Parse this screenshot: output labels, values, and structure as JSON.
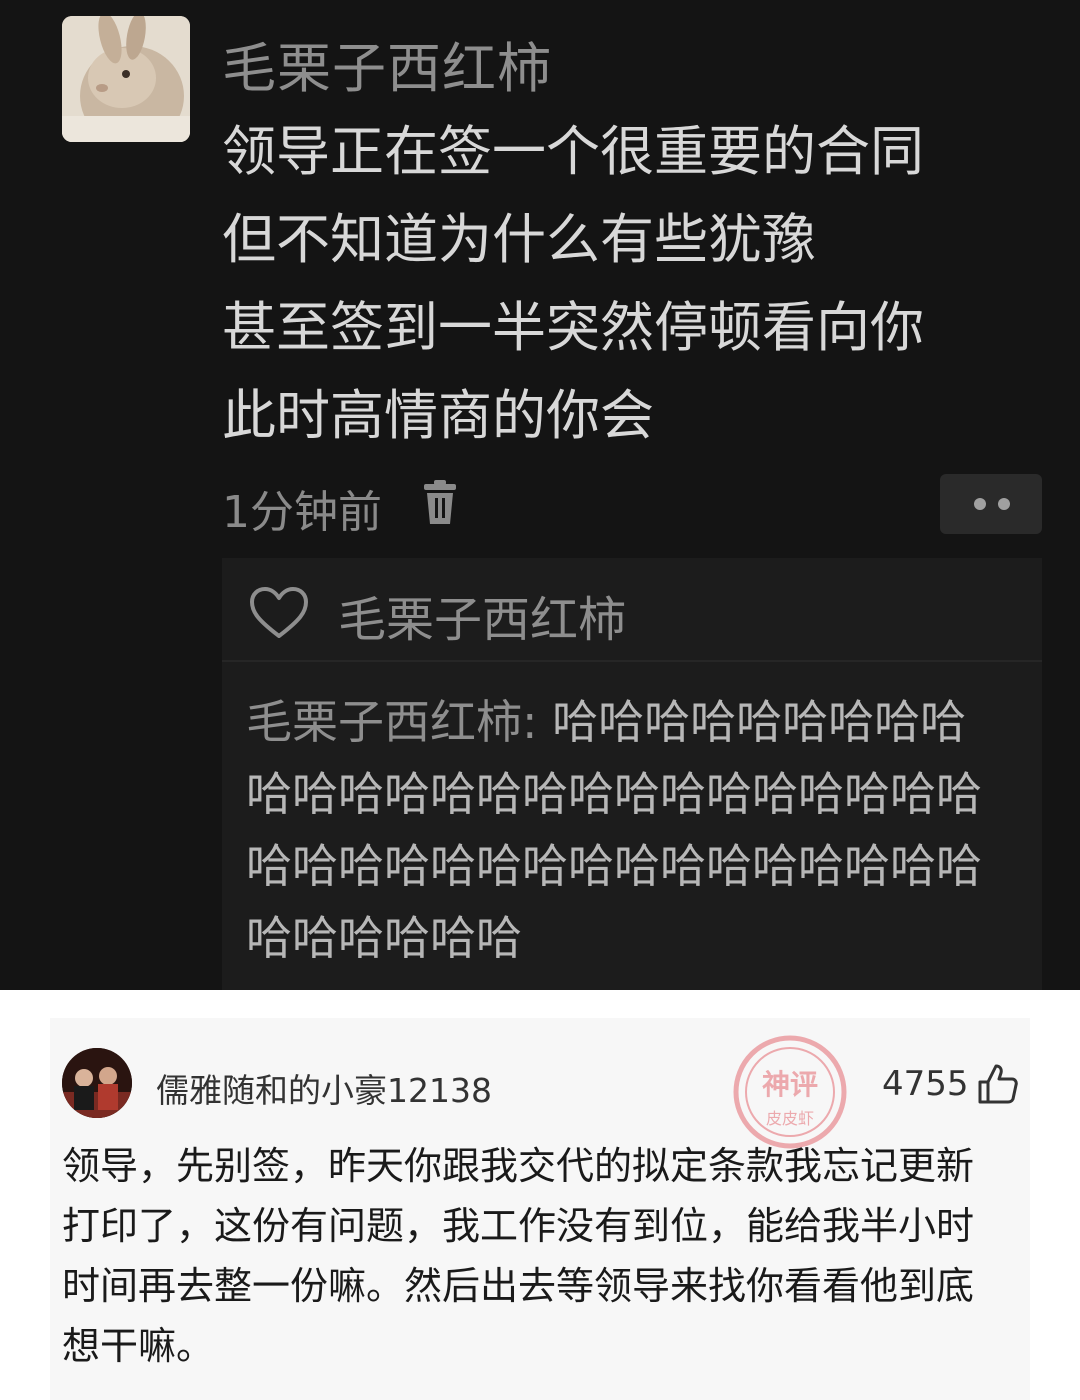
{
  "post": {
    "author": "毛栗子西红柿",
    "lines": [
      "领导正在签一个很重要的合同",
      "但不知道为什么有些犹豫",
      "甚至签到一半突然停顿看向你",
      "此时高情商的你会"
    ],
    "time": "1分钟前",
    "icons": {
      "avatar": "rabbit-avatar-icon",
      "delete": "trash-icon",
      "more": "more-dots-icon"
    },
    "likes": {
      "liker_name": "毛栗子西红柿",
      "icon": "heart-icon"
    },
    "reply": {
      "author_label": "毛栗子西红柿:",
      "lines": [
        "哈哈哈哈哈哈哈哈哈",
        "哈哈哈哈哈哈哈哈哈哈哈哈哈哈哈哈",
        "哈哈哈哈哈哈哈哈哈哈哈哈哈哈哈哈",
        "哈哈哈哈哈哈"
      ]
    }
  },
  "comment": {
    "username": "儒雅随和的小豪12138",
    "like_count": "4755",
    "stamp": {
      "top": "神评",
      "bottom": "皮皮虾",
      "color": "#e04b54"
    },
    "icons": {
      "avatar": "user-avatar-icon",
      "like": "thumbs-up-icon",
      "stamp": "shenping-stamp-icon"
    },
    "lines": [
      "领导，先别签，昨天你跟我交代的拟定条款我忘记更新",
      "打印了，这份有问题，我工作没有到位，能给我半小时",
      "时间再去整一份嘛。然后出去等领导来找你看看他到底",
      "想干嘛。"
    ]
  }
}
